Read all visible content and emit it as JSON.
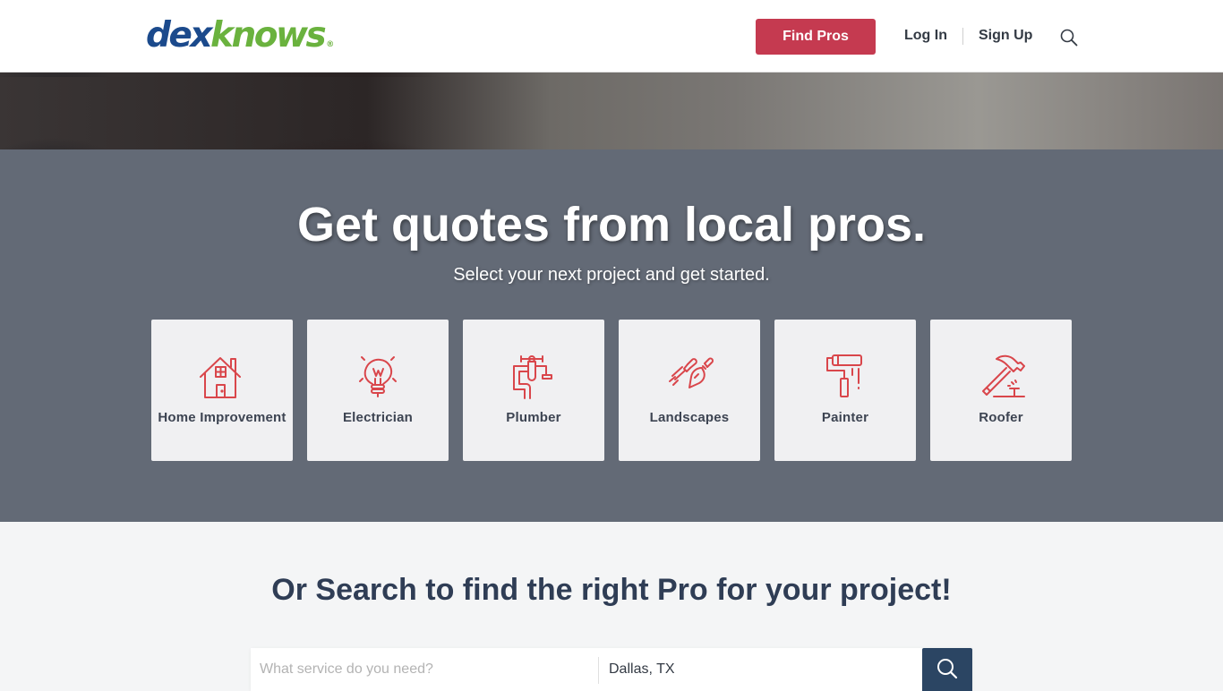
{
  "header": {
    "logo": {
      "part1": "dex",
      "part2": "knows",
      "mark": "®"
    },
    "find_pros_label": "Find Pros",
    "login_label": "Log In",
    "signup_label": "Sign Up",
    "search_icon": "search-icon"
  },
  "hero": {
    "image": "blurred tools background"
  },
  "quote": {
    "title": "Get quotes from local pros.",
    "subtitle": "Select your next project and get started.",
    "categories": [
      {
        "label": "Home Improvement",
        "icon": "house-icon"
      },
      {
        "label": "Electrician",
        "icon": "lightbulb-icon"
      },
      {
        "label": "Plumber",
        "icon": "faucet-icon"
      },
      {
        "label": "Landscapes",
        "icon": "garden-tools-icon"
      },
      {
        "label": "Painter",
        "icon": "paint-roller-icon"
      },
      {
        "label": "Roofer",
        "icon": "hammer-icon"
      }
    ]
  },
  "search": {
    "heading": "Or Search to find the right Pro for your project!",
    "service_placeholder": "What service do you need?",
    "service_value": "",
    "location_value": "Dallas, TX",
    "button_icon": "search-icon"
  },
  "colors": {
    "brand_dark_blue": "#1b4a8c",
    "brand_green": "#6ab23e",
    "accent_red": "#c53a50",
    "icon_red": "#d9464b",
    "section_gray": "#636a76",
    "search_button": "#2b4563"
  }
}
